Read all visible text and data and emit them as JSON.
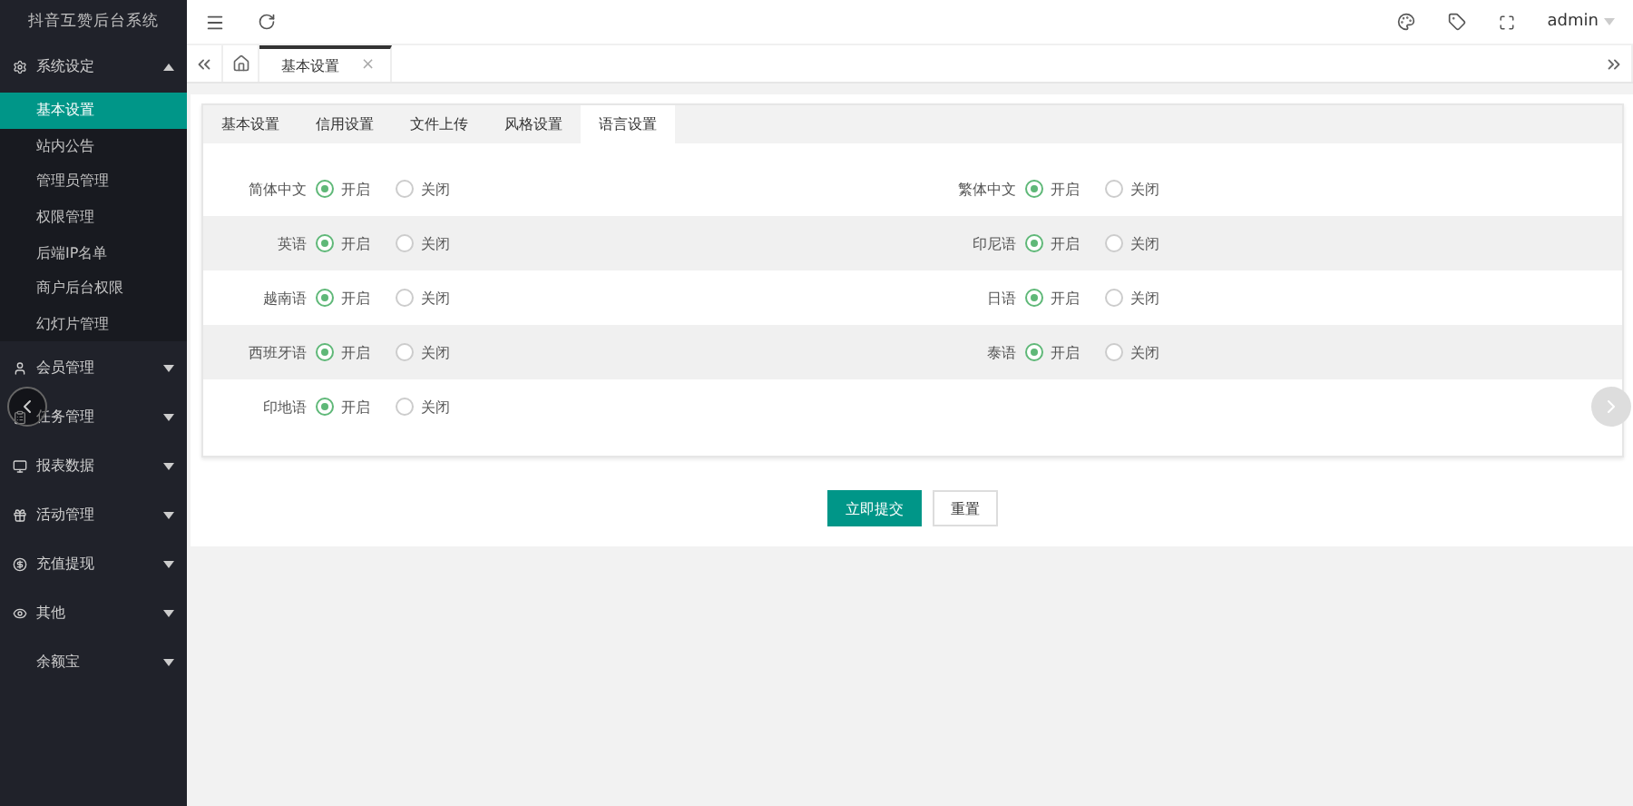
{
  "sidebar": {
    "title": "抖音互赞后台系统",
    "groups": [
      {
        "label": "系统设定",
        "expanded": true,
        "children": [
          {
            "label": "基本设置",
            "selected": true
          },
          {
            "label": "站内公告",
            "selected": false
          },
          {
            "label": "管理员管理",
            "selected": false
          },
          {
            "label": "权限管理",
            "selected": false
          },
          {
            "label": "后端IP名单",
            "selected": false
          },
          {
            "label": "商户后台权限",
            "selected": false
          },
          {
            "label": "幻灯片管理",
            "selected": false
          }
        ]
      },
      {
        "label": "会员管理",
        "expanded": false
      },
      {
        "label": "任务管理",
        "expanded": false
      },
      {
        "label": "报表数据",
        "expanded": false
      },
      {
        "label": "活动管理",
        "expanded": false
      },
      {
        "label": "充值提现",
        "expanded": false
      },
      {
        "label": "其他",
        "expanded": false
      },
      {
        "label": "余额宝",
        "expanded": false
      }
    ]
  },
  "header": {
    "user": "admin"
  },
  "page_tabs": [
    {
      "label": "基本设置",
      "selected": true,
      "close": "×"
    }
  ],
  "settings_tabs": [
    {
      "label": "基本设置",
      "selected": false
    },
    {
      "label": "信用设置",
      "selected": false
    },
    {
      "label": "文件上传",
      "selected": false
    },
    {
      "label": "风格设置",
      "selected": false
    },
    {
      "label": "语言设置",
      "selected": true
    }
  ],
  "rows": [
    {
      "items": [
        {
          "label": "简体中文",
          "options": [
            {
              "label": "开启",
              "selected": true
            },
            {
              "label": "关闭",
              "selected": false
            }
          ]
        },
        {
          "label": "繁体中文",
          "options": [
            {
              "label": "开启",
              "selected": true
            },
            {
              "label": "关闭",
              "selected": false
            }
          ]
        }
      ]
    },
    {
      "items": [
        {
          "label": "英语",
          "options": [
            {
              "label": "开启",
              "selected": true
            },
            {
              "label": "关闭",
              "selected": false
            }
          ]
        },
        {
          "label": "印尼语",
          "options": [
            {
              "label": "开启",
              "selected": true
            },
            {
              "label": "关闭",
              "selected": false
            }
          ]
        }
      ]
    },
    {
      "items": [
        {
          "label": "越南语",
          "options": [
            {
              "label": "开启",
              "selected": true
            },
            {
              "label": "关闭",
              "selected": false
            }
          ]
        },
        {
          "label": "日语",
          "options": [
            {
              "label": "开启",
              "selected": true
            },
            {
              "label": "关闭",
              "selected": false
            }
          ]
        }
      ]
    },
    {
      "items": [
        {
          "label": "西班牙语",
          "options": [
            {
              "label": "开启",
              "selected": true
            },
            {
              "label": "关闭",
              "selected": false
            }
          ]
        },
        {
          "label": "泰语",
          "options": [
            {
              "label": "开启",
              "selected": true
            },
            {
              "label": "关闭",
              "selected": false
            }
          ]
        }
      ]
    },
    {
      "items": [
        {
          "label": "印地语",
          "options": [
            {
              "label": "开启",
              "selected": true
            },
            {
              "label": "关闭",
              "selected": false
            }
          ]
        }
      ]
    }
  ],
  "buttons": [
    {
      "label": "立即提交",
      "kind": "primary"
    },
    {
      "label": "重置",
      "kind": "secondary"
    }
  ]
}
